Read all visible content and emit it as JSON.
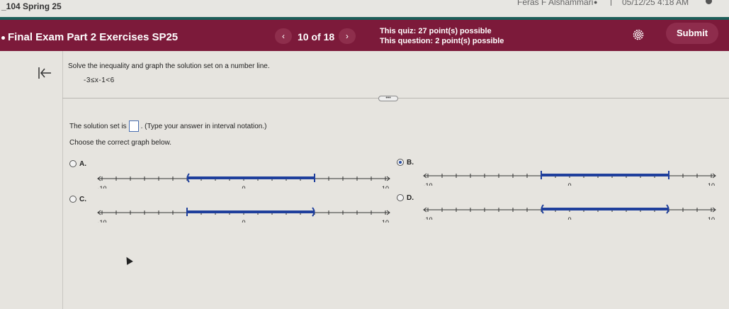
{
  "topbar": {
    "course": "_104 Spring 25",
    "user": "Feras F Alshammari",
    "timestamp": "05/12/25 4:18 AM"
  },
  "header": {
    "exam_title": "Final Exam Part 2 Exercises SP25",
    "prev_label": "‹",
    "counter": "10 of 18",
    "next_label": "›",
    "quiz_points": "This quiz: 27 point(s) possible",
    "question_points": "This question: 2 point(s) possible",
    "submit_label": "Submit"
  },
  "question": {
    "prompt": "Solve the inequality and graph the solution set on a number line.",
    "inequality": "-3≤x-1<6",
    "more_label": "•••",
    "solution_prefix": "The solution set is",
    "solution_suffix": ". (Type your answer in interval notation.)",
    "choose_label": "Choose the correct graph below."
  },
  "options": [
    {
      "letter": "A.",
      "selected": false,
      "left_tick": "-10",
      "mid_tick": "0",
      "right_tick": "10",
      "from": -4,
      "to": 5,
      "left_closed": false,
      "right_closed": true,
      "segment": true
    },
    {
      "letter": "B.",
      "selected": true,
      "left_tick": "-10",
      "mid_tick": "0",
      "right_tick": "10",
      "from": -2,
      "to": 7,
      "left_closed": true,
      "right_closed": true,
      "segment": true
    },
    {
      "letter": "C.",
      "selected": false,
      "left_tick": "-10",
      "mid_tick": "0",
      "right_tick": "10",
      "from": -4,
      "to": 5,
      "left_closed": true,
      "right_closed": false,
      "segment": true
    },
    {
      "letter": "D.",
      "selected": false,
      "left_tick": "-10",
      "mid_tick": "0",
      "right_tick": "10",
      "from": -2,
      "to": 7,
      "left_closed": false,
      "right_closed": false,
      "segment": true
    }
  ],
  "colors": {
    "maroon": "#7c1a3a",
    "teal": "#1d5e59",
    "line_blue": "#1f3f9c"
  }
}
